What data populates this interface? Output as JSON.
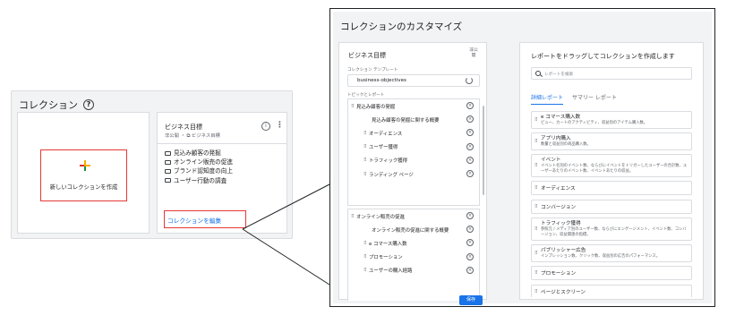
{
  "left_card": {
    "title": "コレクション",
    "help_icon": "help-circle-icon",
    "new_collection_label": "新しいコレクションを作成",
    "business": {
      "title": "ビジネス目標",
      "subtitle": "非公開 ・ ⧉ ビジネス目標",
      "items": [
        "見込み顧客の発掘",
        "オンライン販売の促進",
        "ブランド認知度の向上",
        "ユーザー行動の調査"
      ],
      "edit_label": "コレクションを編集"
    }
  },
  "panel": {
    "title": "コレクションのカスタマイズ",
    "left": {
      "title": "ビジネス目標",
      "publish_label": "非公開",
      "template_label": "コレクション テンプレート",
      "template_value": "business-objectives",
      "topics_label": "トピックとレポート",
      "group1": [
        {
          "label": "見込み顧客の発掘",
          "level": "top"
        },
        {
          "label": "見込み顧客の発掘に関する概要",
          "level": "sub"
        },
        {
          "label": "オーディエンス",
          "level": "child"
        },
        {
          "label": "ユーザー獲得",
          "level": "child"
        },
        {
          "label": "トラフィック獲得",
          "level": "child"
        },
        {
          "label": "ランディング ページ",
          "level": "child"
        },
        {
          "label": "オンライン販売の促進",
          "level": "top"
        }
      ],
      "group2": [
        {
          "label": "オンライン販売の促進",
          "level": "top"
        },
        {
          "label": "オンライン販売の促進に関する概要",
          "level": "sub"
        },
        {
          "label": "e コマース購入数",
          "level": "child"
        },
        {
          "label": "プロモーション",
          "level": "child"
        },
        {
          "label": "ユーザーの購入経路",
          "level": "child"
        }
      ],
      "save_label": "保存"
    },
    "right": {
      "title": "レポートをドラッグしてコレクションを作成します",
      "search_placeholder": "レポートを検索",
      "tabs": [
        "詳細レポート",
        "サマリー レポート"
      ],
      "reports": [
        {
          "title": "e コマース購入数",
          "desc": "ビュー、カートのアクティビティ、収益別のアイテム購入数。"
        },
        {
          "title": "アプリ内購入",
          "desc": "数量と収益別の商品購入数。"
        },
        {
          "title": "イベント",
          "desc": "イベント名別のイベント数、ならびにイベントをトリガーしたユーザーの合計数、ユーザーあたりのイベント数、イベントあたりの収益。"
        },
        {
          "title": "オーディエンス",
          "desc": ""
        },
        {
          "title": "コンバージョン",
          "desc": ""
        },
        {
          "title": "トラフィック獲得",
          "desc": "参照元 / メディア別のユーザー数、ならびにエンゲージメント、イベント数、コンバージョン、収益関連の指標。"
        },
        {
          "title": "パブリッシャー広告",
          "desc": "インプレッション数、クリック数、収益別の広告のパフォーマンス。"
        },
        {
          "title": "プロモーション",
          "desc": ""
        },
        {
          "title": "ページとスクリーン",
          "desc": ""
        }
      ]
    }
  },
  "colors": {
    "accent": "#1a73e8",
    "highlight_red": "#e53935",
    "panel_bg": "#f1f3f4"
  }
}
